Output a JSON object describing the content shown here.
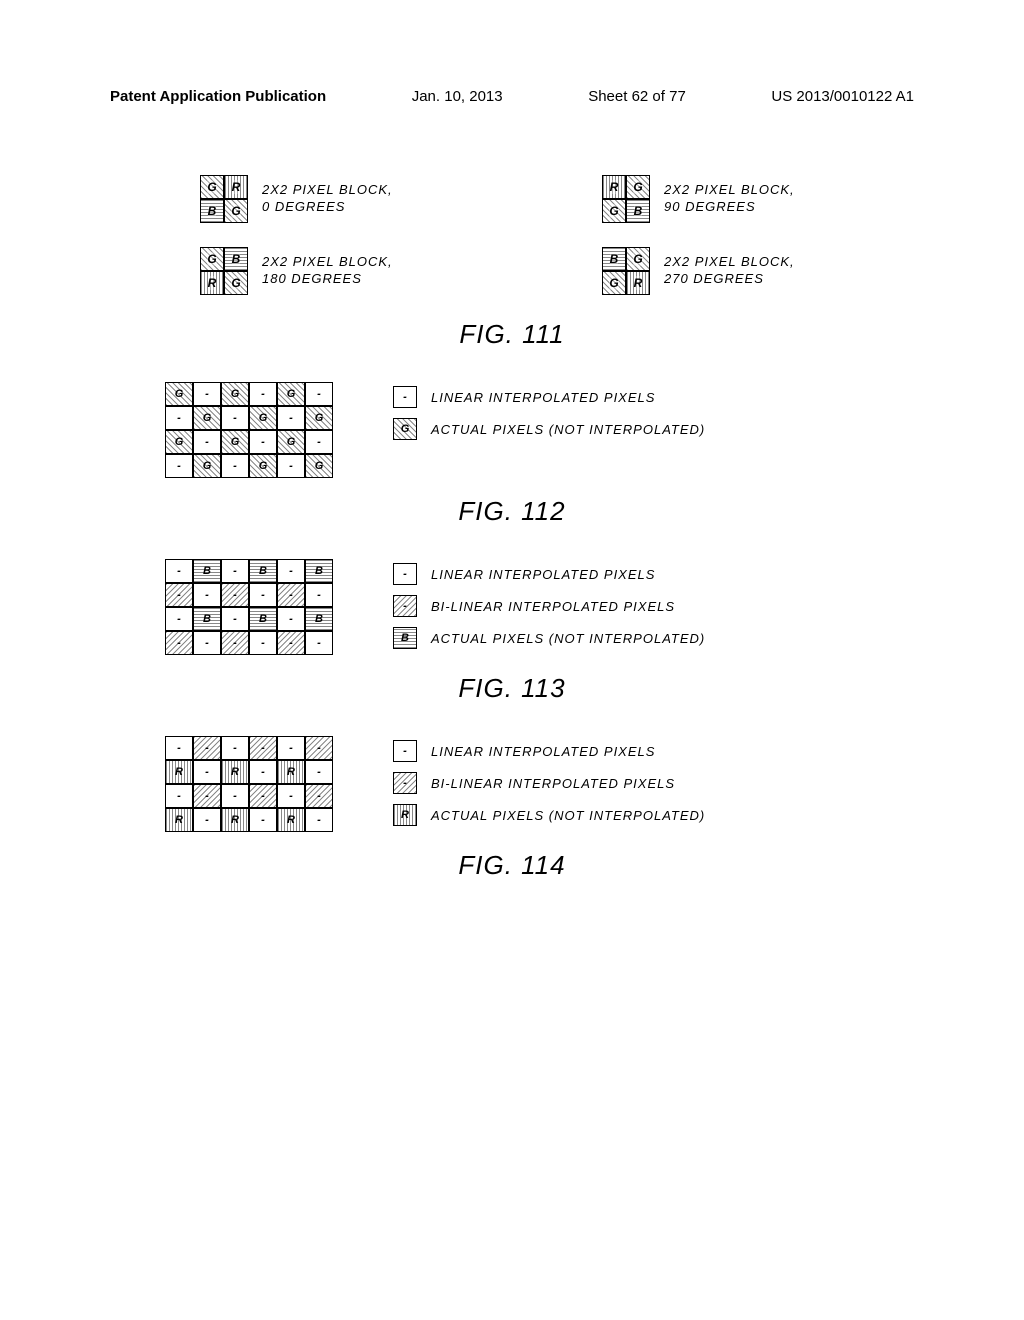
{
  "header": {
    "left": "Patent Application Publication",
    "date": "Jan. 10, 2013",
    "sheet": "Sheet 62 of 77",
    "pubnum": "US 2013/0010122 A1"
  },
  "fig111": {
    "caption": "FIG. 111",
    "blocks": [
      {
        "cells": [
          "G",
          "R",
          "B",
          "G"
        ],
        "fills": [
          "hatch-diag",
          "hatch-vert",
          "hatch-horiz",
          "hatch-diag"
        ],
        "label1": "2X2 PIXEL BLOCK,",
        "label2": "0 DEGREES"
      },
      {
        "cells": [
          "R",
          "G",
          "G",
          "B"
        ],
        "fills": [
          "hatch-vert",
          "hatch-diag",
          "hatch-diag",
          "hatch-horiz"
        ],
        "label1": "2X2 PIXEL BLOCK,",
        "label2": "90 DEGREES"
      },
      {
        "cells": [
          "G",
          "B",
          "R",
          "G"
        ],
        "fills": [
          "hatch-diag",
          "hatch-horiz",
          "hatch-vert",
          "hatch-diag"
        ],
        "label1": "2X2 PIXEL BLOCK,",
        "label2": "180 DEGREES"
      },
      {
        "cells": [
          "B",
          "G",
          "G",
          "R"
        ],
        "fills": [
          "hatch-horiz",
          "hatch-diag",
          "hatch-diag",
          "hatch-vert"
        ],
        "label1": "2X2 PIXEL BLOCK,",
        "label2": "270 DEGREES"
      }
    ]
  },
  "fig112": {
    "caption": "FIG. 112",
    "grid": {
      "rows": 4,
      "cols": 6,
      "cells": [
        {
          "t": "G",
          "f": "hatch-diag"
        },
        {
          "t": "-",
          "f": "plain"
        },
        {
          "t": "G",
          "f": "hatch-diag"
        },
        {
          "t": "-",
          "f": "plain"
        },
        {
          "t": "G",
          "f": "hatch-diag"
        },
        {
          "t": "-",
          "f": "plain"
        },
        {
          "t": "-",
          "f": "plain"
        },
        {
          "t": "G",
          "f": "hatch-diag"
        },
        {
          "t": "-",
          "f": "plain"
        },
        {
          "t": "G",
          "f": "hatch-diag"
        },
        {
          "t": "-",
          "f": "plain"
        },
        {
          "t": "G",
          "f": "hatch-diag"
        },
        {
          "t": "G",
          "f": "hatch-diag"
        },
        {
          "t": "-",
          "f": "plain"
        },
        {
          "t": "G",
          "f": "hatch-diag"
        },
        {
          "t": "-",
          "f": "plain"
        },
        {
          "t": "G",
          "f": "hatch-diag"
        },
        {
          "t": "-",
          "f": "plain"
        },
        {
          "t": "-",
          "f": "plain"
        },
        {
          "t": "G",
          "f": "hatch-diag"
        },
        {
          "t": "-",
          "f": "plain"
        },
        {
          "t": "G",
          "f": "hatch-diag"
        },
        {
          "t": "-",
          "f": "plain"
        },
        {
          "t": "G",
          "f": "hatch-diag"
        }
      ]
    },
    "legend": [
      {
        "swatch": {
          "t": "-",
          "f": "plain"
        },
        "text": "LINEAR INTERPOLATED PIXELS"
      },
      {
        "swatch": {
          "t": "G",
          "f": "hatch-diag"
        },
        "text": "ACTUAL PIXELS (NOT INTERPOLATED)"
      }
    ]
  },
  "fig113": {
    "caption": "FIG. 113",
    "grid": {
      "rows": 4,
      "cols": 6,
      "cells": [
        {
          "t": "-",
          "f": "plain"
        },
        {
          "t": "B",
          "f": "hatch-horiz"
        },
        {
          "t": "-",
          "f": "plain"
        },
        {
          "t": "B",
          "f": "hatch-horiz"
        },
        {
          "t": "-",
          "f": "plain"
        },
        {
          "t": "B",
          "f": "hatch-horiz"
        },
        {
          "t": "-",
          "f": "hatch-diag2"
        },
        {
          "t": "-",
          "f": "plain"
        },
        {
          "t": "-",
          "f": "hatch-diag2"
        },
        {
          "t": "-",
          "f": "plain"
        },
        {
          "t": "-",
          "f": "hatch-diag2"
        },
        {
          "t": "-",
          "f": "plain"
        },
        {
          "t": "-",
          "f": "plain"
        },
        {
          "t": "B",
          "f": "hatch-horiz"
        },
        {
          "t": "-",
          "f": "plain"
        },
        {
          "t": "B",
          "f": "hatch-horiz"
        },
        {
          "t": "-",
          "f": "plain"
        },
        {
          "t": "B",
          "f": "hatch-horiz"
        },
        {
          "t": "-",
          "f": "hatch-diag2"
        },
        {
          "t": "-",
          "f": "plain"
        },
        {
          "t": "-",
          "f": "hatch-diag2"
        },
        {
          "t": "-",
          "f": "plain"
        },
        {
          "t": "-",
          "f": "hatch-diag2"
        },
        {
          "t": "-",
          "f": "plain"
        }
      ]
    },
    "legend": [
      {
        "swatch": {
          "t": "-",
          "f": "plain"
        },
        "text": "LINEAR INTERPOLATED PIXELS"
      },
      {
        "swatch": {
          "t": "-",
          "f": "hatch-diag2"
        },
        "text": "BI-LINEAR INTERPOLATED PIXELS"
      },
      {
        "swatch": {
          "t": "B",
          "f": "hatch-horiz"
        },
        "text": "ACTUAL PIXELS (NOT INTERPOLATED)"
      }
    ]
  },
  "fig114": {
    "caption": "FIG. 114",
    "grid": {
      "rows": 4,
      "cols": 6,
      "cells": [
        {
          "t": "-",
          "f": "plain"
        },
        {
          "t": "-",
          "f": "hatch-diag2"
        },
        {
          "t": "-",
          "f": "plain"
        },
        {
          "t": "-",
          "f": "hatch-diag2"
        },
        {
          "t": "-",
          "f": "plain"
        },
        {
          "t": "-",
          "f": "hatch-diag2"
        },
        {
          "t": "R",
          "f": "hatch-vert"
        },
        {
          "t": "-",
          "f": "plain"
        },
        {
          "t": "R",
          "f": "hatch-vert"
        },
        {
          "t": "-",
          "f": "plain"
        },
        {
          "t": "R",
          "f": "hatch-vert"
        },
        {
          "t": "-",
          "f": "plain"
        },
        {
          "t": "-",
          "f": "plain"
        },
        {
          "t": "-",
          "f": "hatch-diag2"
        },
        {
          "t": "-",
          "f": "plain"
        },
        {
          "t": "-",
          "f": "hatch-diag2"
        },
        {
          "t": "-",
          "f": "plain"
        },
        {
          "t": "-",
          "f": "hatch-diag2"
        },
        {
          "t": "R",
          "f": "hatch-vert"
        },
        {
          "t": "-",
          "f": "plain"
        },
        {
          "t": "R",
          "f": "hatch-vert"
        },
        {
          "t": "-",
          "f": "plain"
        },
        {
          "t": "R",
          "f": "hatch-vert"
        },
        {
          "t": "-",
          "f": "plain"
        }
      ]
    },
    "legend": [
      {
        "swatch": {
          "t": "-",
          "f": "plain"
        },
        "text": "LINEAR INTERPOLATED PIXELS"
      },
      {
        "swatch": {
          "t": "-",
          "f": "hatch-diag2"
        },
        "text": "BI-LINEAR INTERPOLATED PIXELS"
      },
      {
        "swatch": {
          "t": "R",
          "f": "hatch-vert"
        },
        "text": "ACTUAL PIXELS (NOT INTERPOLATED)"
      }
    ]
  }
}
